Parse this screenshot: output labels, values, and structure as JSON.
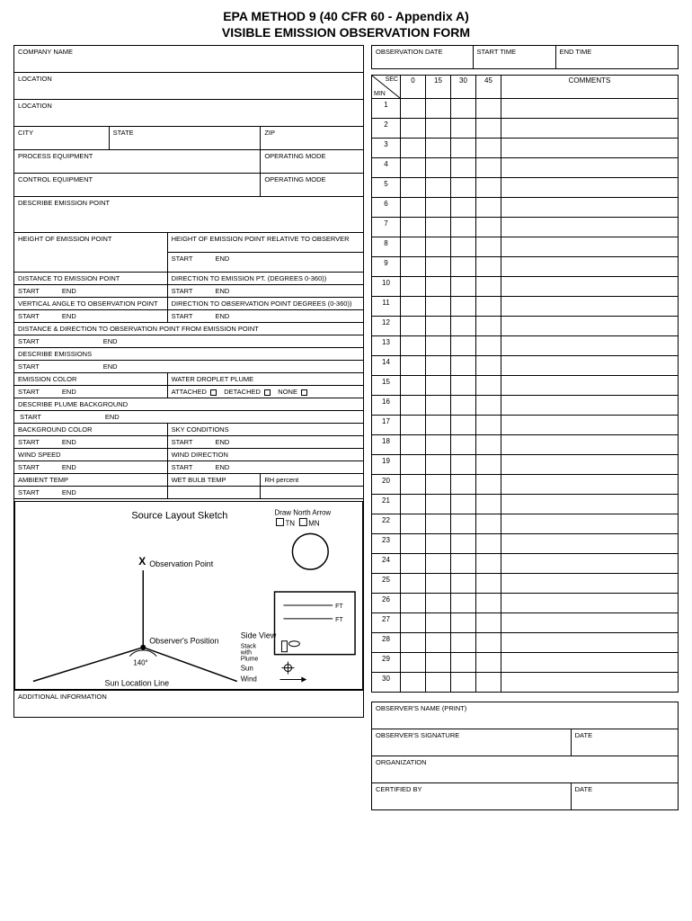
{
  "header": {
    "title": "EPA METHOD 9 (40 CFR 60 - Appendix A)",
    "subtitle": "VISIBLE EMISSION OBSERVATION FORM"
  },
  "left": {
    "company": "COMPANY NAME",
    "location1": "LOCATION",
    "location2": "LOCATION",
    "city": "CITY",
    "state": "STATE",
    "zip": "ZIP",
    "process_equip": "PROCESS EQUIPMENT",
    "operating_mode1": "OPERATING MODE",
    "control_equip": "CONTROL EQUIPMENT",
    "operating_mode2": "OPERATING MODE",
    "describe_emission_point": "DESCRIBE EMISSION POINT",
    "height_ep": "HEIGHT OF EMISSION POINT",
    "height_ep_rel": "HEIGHT OF EMISSION POINT RELATIVE TO OBSERVER",
    "start": "START",
    "end": "END",
    "distance_ep": "DISTANCE TO EMISSION POINT",
    "direction_ep": "DIRECTION TO EMISSION PT. (DEGREES 0-360))",
    "vert_angle": "VERTICAL ANGLE TO OBSERVATION POINT",
    "direction_op": "DIRECTION TO OBSERVATION POINT DEGREES (0-360))",
    "dist_dir_op": "DISTANCE & DIRECTION TO OBSERVATION POINT FROM EMISSION POINT",
    "describe_emissions": "DESCRIBE EMISSIONS",
    "emission_color": "EMISSION COLOR",
    "water_droplet": "WATER DROPLET PLUME",
    "attached": "ATTACHED",
    "detached": "DETACHED",
    "none": "NONE",
    "describe_plume_bg": "DESCRIBE PLUME BACKGROUND",
    "bg_color": "BACKGROUND COLOR",
    "sky_cond": "SKY CONDITIONS",
    "wind_speed": "WIND SPEED",
    "wind_dir": "WIND DIRECTION",
    "ambient_temp": "AMBIENT TEMP",
    "wet_bulb": "WET BULB TEMP",
    "rh": "RH percent",
    "sketch_title": "Source Layout Sketch",
    "draw_north": "Draw North Arrow",
    "tn": "TN",
    "mn": "MN",
    "obs_point": "Observation Point",
    "obs_position": "Observer's Position",
    "angle140": "140°",
    "sun_line": "Sun Location Line",
    "side_view": "Side View",
    "stack_plume": "Stack\nwith\nPlume",
    "sun": "Sun",
    "wind": "Wind",
    "ft": "FT",
    "additional_info": "ADDITIONAL INFORMATION"
  },
  "right": {
    "obs_date": "OBSERVATION DATE",
    "start_time": "START TIME",
    "end_time": "END TIME",
    "min": "MIN",
    "sec": "SEC",
    "s0": "0",
    "s15": "15",
    "s30": "30",
    "s45": "45",
    "comments": "COMMENTS",
    "rows": [
      "1",
      "2",
      "3",
      "4",
      "5",
      "6",
      "7",
      "8",
      "9",
      "10",
      "11",
      "12",
      "13",
      "14",
      "15",
      "16",
      "17",
      "18",
      "19",
      "20",
      "21",
      "22",
      "23",
      "24",
      "25",
      "26",
      "27",
      "28",
      "29",
      "30"
    ],
    "obs_name": "OBSERVER'S NAME (PRINT)",
    "obs_sig": "OBSERVER'S SIGNATURE",
    "date": "DATE",
    "org": "ORGANIZATION",
    "cert_by": "CERTIFIED BY"
  }
}
